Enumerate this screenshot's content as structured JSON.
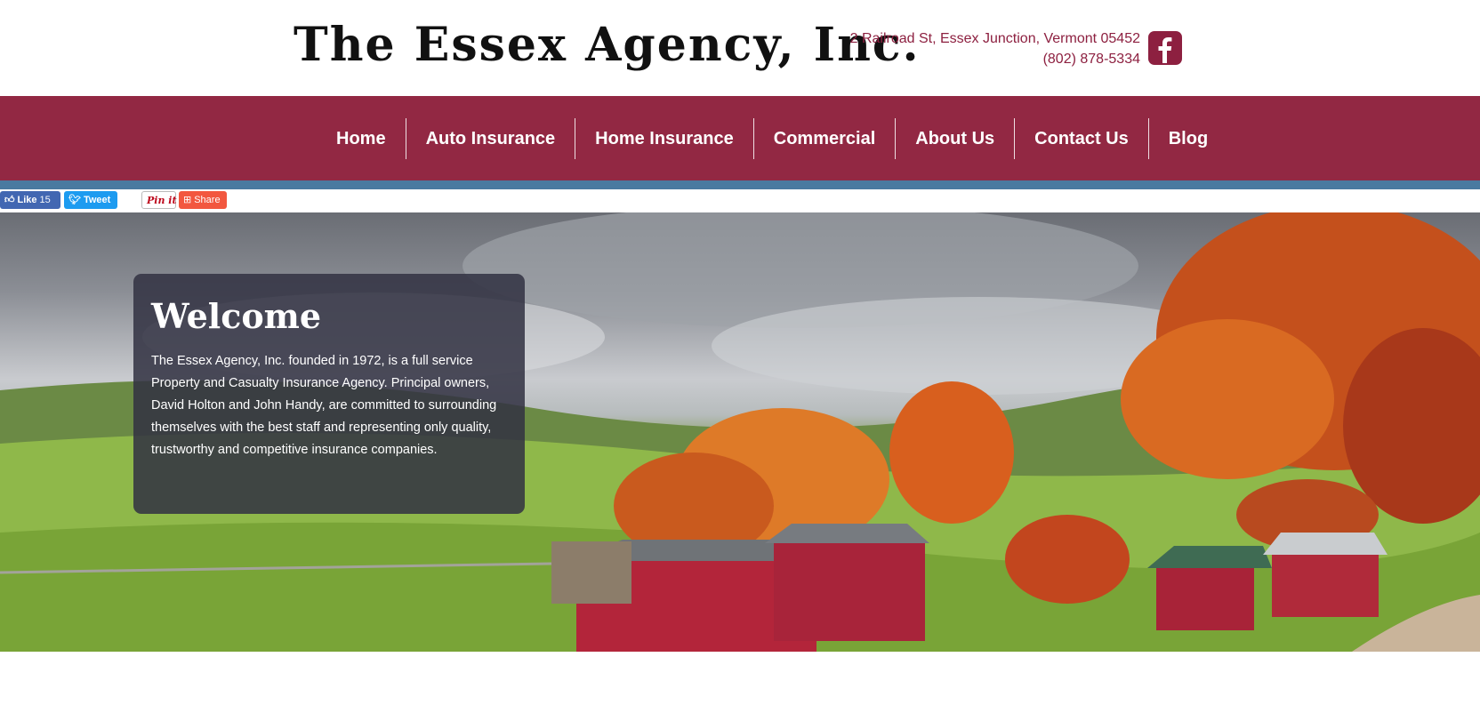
{
  "header": {
    "logo_text": "The Essex Agency, Inc.",
    "address": "2 Railroad St, Essex Junction, Vermont 05452",
    "phone": "(802) 878-5334"
  },
  "nav": {
    "items": [
      {
        "label": "Home"
      },
      {
        "label": "Auto Insurance"
      },
      {
        "label": "Home Insurance"
      },
      {
        "label": "Commercial"
      },
      {
        "label": "About Us"
      },
      {
        "label": "Contact Us"
      },
      {
        "label": "Blog"
      }
    ]
  },
  "social": {
    "like_label": "Like",
    "like_count": "15",
    "tweet_label": "Tweet",
    "pin_label": "Pin it",
    "share_label": "Share"
  },
  "welcome": {
    "title": "Welcome",
    "body": "The Essex Agency, Inc. founded in 1972, is a full service Property and Casualty Insurance Agency. Principal owners, David Holton and John Handy, are committed to surrounding themselves with the best staff and representing only quality, trustworthy and competitive insurance companies."
  },
  "icons": {
    "facebook": "facebook-icon",
    "like": "thumbs-up-icon",
    "tweet": "twitter-bird-icon",
    "share": "plus-box-icon"
  },
  "colors": {
    "brand": "#922843",
    "accent_strip": "#4a7aa0",
    "text_accent": "#8d2040",
    "welcome_panel": "#323242"
  }
}
